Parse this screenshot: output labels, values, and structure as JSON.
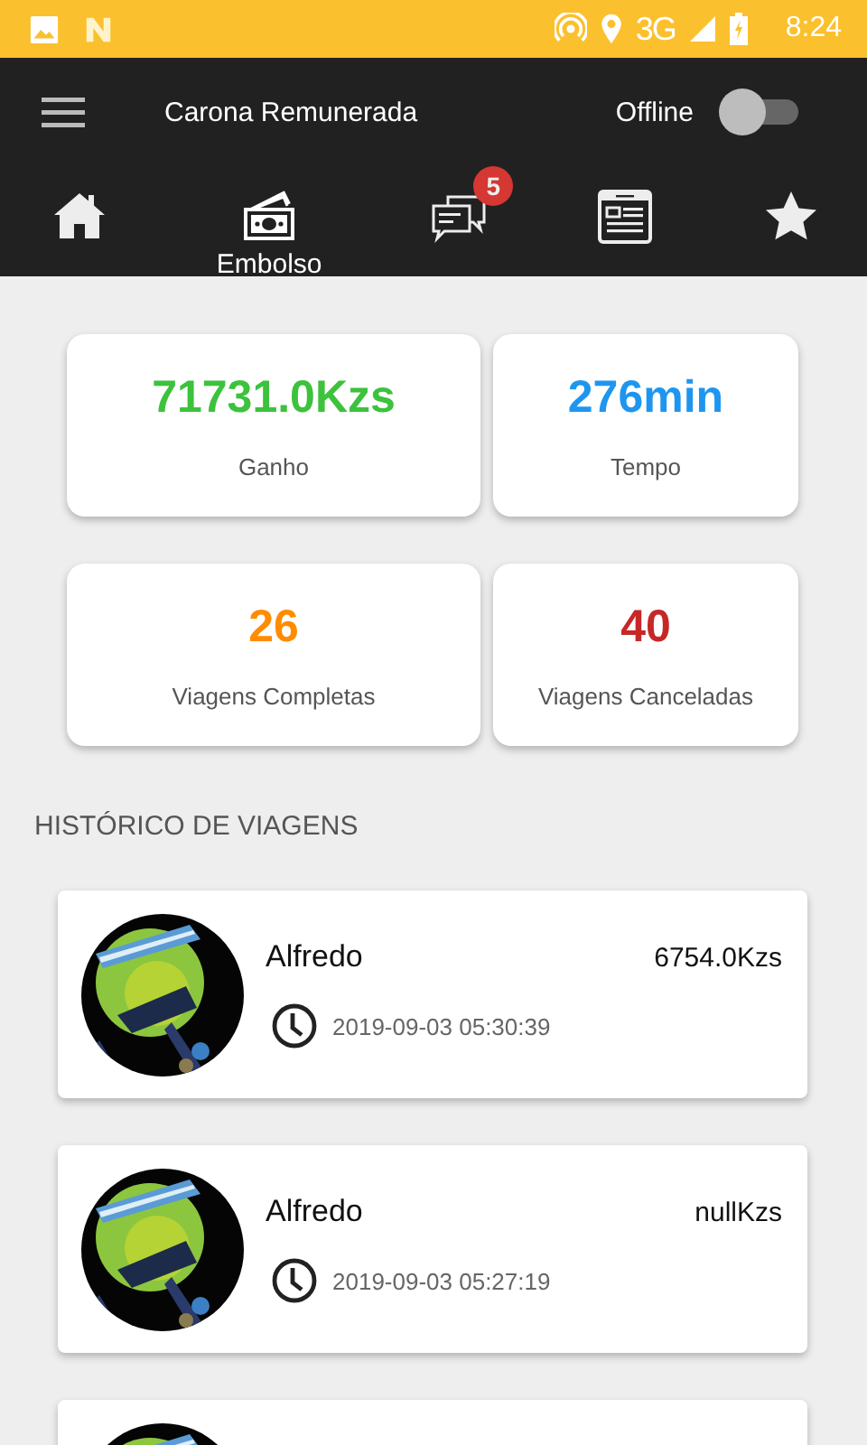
{
  "status_bar": {
    "network": "3G",
    "time": "8:24"
  },
  "toolbar": {
    "title": "Carona Remunerada",
    "status_label": "Offline",
    "online_switch": {
      "on": false
    }
  },
  "tabs": [
    {
      "kind": "home",
      "selected": false
    },
    {
      "kind": "money",
      "label": "Embolso",
      "selected": true
    },
    {
      "kind": "chat",
      "badge": "5",
      "selected": false
    },
    {
      "kind": "news",
      "selected": false
    },
    {
      "kind": "star",
      "selected": false
    }
  ],
  "stats": [
    {
      "value": "71731.0Kzs",
      "label": "Ganho",
      "color": "#3cc23c"
    },
    {
      "value": "276min",
      "label": "Tempo",
      "color": "#1e96f0"
    },
    {
      "value": "26",
      "label": "Viagens Completas",
      "color": "#ff8c00"
    },
    {
      "value": "40",
      "label": "Viagens Canceladas",
      "color": "#c62828"
    }
  ],
  "history": {
    "title": "HISTÓRICO DE VIAGENS",
    "trips": [
      {
        "avatar": {
          "kind": "picture"
        },
        "name": "Alfredo",
        "amount": "6754.0Kzs",
        "datetime": "2019-09-03 05:30:39"
      },
      {
        "avatar": {
          "kind": "picture"
        },
        "name": "Alfredo",
        "amount": "nullKzs",
        "datetime": "2019-09-03 05:27:19"
      },
      {
        "avatar": {
          "kind": "picture"
        }
      }
    ]
  }
}
